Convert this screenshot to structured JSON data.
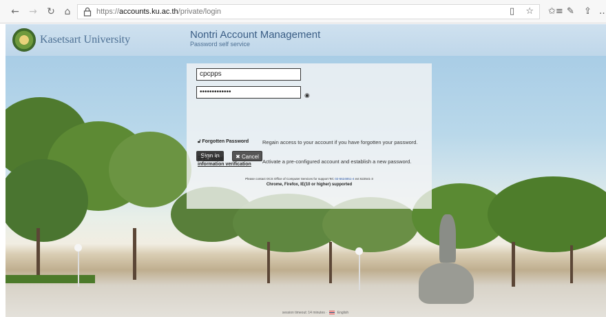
{
  "browser": {
    "url_prefix": "https://",
    "url_host": "accounts.ku.ac.th",
    "url_path": "/private/login",
    "icons": {
      "back": "arrow-left-icon",
      "forward": "arrow-right-icon",
      "refresh": "refresh-icon",
      "home": "home-icon",
      "lock": "lock-icon",
      "reading": "reading-view-icon",
      "favorite": "star-icon",
      "favorites_bar": "favorites-icon",
      "pen": "pen-icon",
      "share": "share-icon",
      "more": "more-icon"
    }
  },
  "header": {
    "university": "Kasetsart University",
    "app_title": "Nontri Account Management",
    "app_subtitle": "Password self service"
  },
  "login": {
    "username_value": "cpcpps",
    "password_value": "•••••••••••••",
    "signin_label": "Sign in",
    "cancel_label": "✖ Cancel",
    "options": [
      {
        "label": "Forgotten Password",
        "description": "Regain access to your account if you have forgotten your password."
      },
      {
        "label_line1": "Personal",
        "label_line2": "information verification",
        "description": "Activate a pre-configured account and establish a new password."
      }
    ],
    "support_prefix": "Please contact OCS Office of Computer Services for support Tel. ",
    "support_phone": "02-5624851-4",
    "support_suffix": " ext 622541-3",
    "supported_browsers": "Chrome, Firefox, IE(10 or higher) supported"
  },
  "footer": {
    "session_text": "session timeout: 14 minutes",
    "language": "English"
  },
  "colors": {
    "banner": "#c7dcec",
    "title": "#3a5d85",
    "button": "#3c3c3c"
  }
}
